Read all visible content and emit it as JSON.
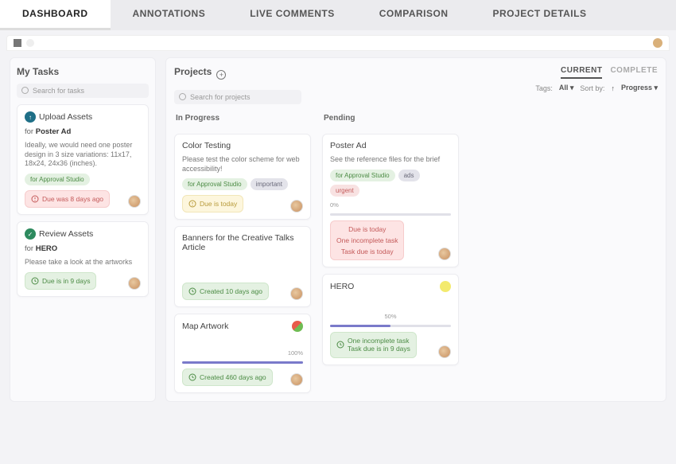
{
  "nav": {
    "dashboard": "DASHBOARD",
    "annotations": "ANNOTATIONS",
    "live_comments": "LIVE COMMENTS",
    "comparison": "COMPARISON",
    "project_details": "PROJECT DETAILS"
  },
  "tasks": {
    "heading": "My Tasks",
    "search_placeholder": "Search for tasks",
    "items": [
      {
        "icon": "upload",
        "title": "Upload Assets",
        "for_prefix": "for ",
        "for": "Poster Ad",
        "desc": "Ideally, we would need one poster design in 3 size variations: 11x17, 18x24, 24x36 (inches).",
        "pill": "for Approval Studio",
        "status": "Due was 8 days ago"
      },
      {
        "icon": "review",
        "title": "Review Assets",
        "for_prefix": "for ",
        "for": "HERO",
        "desc": "Please take a look at the artworks",
        "pill": null,
        "status": "Due is in 9 days"
      }
    ]
  },
  "projects": {
    "heading": "Projects",
    "search_placeholder": "Search for projects",
    "subtabs": {
      "current": "CURRENT",
      "complete": "COMPLETE"
    },
    "filters": {
      "tags_label": "Tags:",
      "tags_value": "All",
      "sort_label": "Sort by:",
      "sort_value": "Progress"
    },
    "columns": {
      "in_progress": {
        "label": "In Progress",
        "cards": [
          {
            "title": "Color Testing",
            "desc": "Please test the color scheme for web accessibility!",
            "pills": [
              "for Approval Studio",
              "important"
            ],
            "status": "Due is today"
          },
          {
            "title": "Banners for the Creative Talks Article",
            "status": "Created 10 days ago"
          },
          {
            "title": "Map Artwork",
            "progress_label": "100%",
            "progress": 100,
            "status": "Created 460 days ago"
          }
        ]
      },
      "pending": {
        "label": "Pending",
        "cards": [
          {
            "title": "Poster Ad",
            "desc": "See the reference files for the brief",
            "pills": [
              "for Approval Studio",
              "ads",
              "urgent"
            ],
            "progress_label": "0%",
            "progress": 0,
            "status_lines": [
              "Due is today",
              "One incomplete task",
              "Task due is today"
            ]
          },
          {
            "title": "HERO",
            "progress_label": "50%",
            "progress": 50,
            "status_lines": [
              "One incomplete task",
              "Task due is in 9 days"
            ]
          }
        ]
      }
    }
  }
}
